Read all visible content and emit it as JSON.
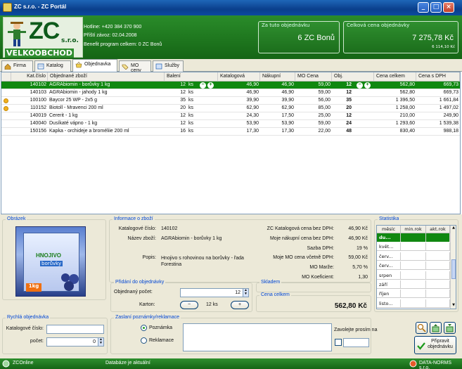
{
  "window": {
    "title": "ZC s.r.o. - ZC Portál"
  },
  "header": {
    "logo_text": "ZC",
    "logo_sro": "s.r.o.",
    "logo_tagline": "VELKOOBCHOD",
    "hotline": "Hotline: +420 384 370 900",
    "next_delivery": "Příští závoz: 02.04.2008",
    "benefit": "Benefit program celkem: 0 ZC Bonů",
    "bonus_label": "Za tuto objednávku",
    "bonus_value": "6 ZC Bonů",
    "total_label": "Celková cena objednávky",
    "total_value": "7 275,78 Kč",
    "total_sub": "6 114,10 Kč"
  },
  "tabs": [
    {
      "label": "Firma"
    },
    {
      "label": "Katalog"
    },
    {
      "label": "Objednavka"
    },
    {
      "label": "MO ceny"
    },
    {
      "label": "Služby"
    }
  ],
  "grid": {
    "columns": [
      "Kat.číslo",
      "Objednané zboží",
      "Balení",
      "Katalogová",
      "Nákupní",
      "MO Cena",
      "Obj.",
      "Cena celkem",
      "Cena s DPH"
    ],
    "rows": [
      {
        "dot": false,
        "kat": "140102",
        "name": "AGRAbiomin - borůvky 1 kg",
        "bal": "12",
        "unit": "ks",
        "katal": "46,90",
        "nak": "46,90",
        "mo": "59,00",
        "obj": "12",
        "celkem": "562,80",
        "dph": "669,73",
        "selected": true
      },
      {
        "dot": false,
        "kat": "140103",
        "name": "AGRAbiomin - jahody 1 kg",
        "bal": "12",
        "unit": "ks",
        "katal": "46,90",
        "nak": "46,90",
        "mo": "59,00",
        "obj": "12",
        "celkem": "562,80",
        "dph": "669,73",
        "selected": false
      },
      {
        "dot": true,
        "kat": "100100",
        "name": "Baycor 25 WP - 2x5 g",
        "bal": "35",
        "unit": "ks",
        "katal": "39,90",
        "nak": "39,90",
        "mo": "56,00",
        "obj": "35",
        "celkem": "1 396,50",
        "dph": "1 661,84",
        "selected": false
      },
      {
        "dot": true,
        "kat": "110152",
        "name": "Biotoll - Mravenci 200 ml",
        "bal": "20",
        "unit": "ks",
        "katal": "62,90",
        "nak": "62,90",
        "mo": "85,00",
        "obj": "20",
        "celkem": "1 258,00",
        "dph": "1 497,02",
        "selected": false
      },
      {
        "dot": false,
        "kat": "140019",
        "name": "Cererit - 1 kg",
        "bal": "12",
        "unit": "ks",
        "katal": "24,30",
        "nak": "17,50",
        "mo": "25,00",
        "obj": "12",
        "celkem": "210,00",
        "dph": "249,90",
        "selected": false
      },
      {
        "dot": false,
        "kat": "140040",
        "name": "Dusíkaté vápno - 1 kg",
        "bal": "12",
        "unit": "ks",
        "katal": "53,90",
        "nak": "53,90",
        "mo": "59,00",
        "obj": "24",
        "celkem": "1 293,60",
        "dph": "1 539,38",
        "selected": false
      },
      {
        "dot": false,
        "kat": "150156",
        "name": "Kapka - orchideje a broméliie 200 ml",
        "bal": "16",
        "unit": "ks",
        "katal": "17,30",
        "nak": "17,30",
        "mo": "22,00",
        "obj": "48",
        "celkem": "830,40",
        "dph": "988,18",
        "selected": false
      }
    ]
  },
  "image_panel": {
    "title": "Obrázek",
    "product_label": "HNOJIVO",
    "product_sub": "borůvky",
    "product_weight": "1kg"
  },
  "info": {
    "title": "Informace o zboží",
    "kat_label": "Katalogové číslo:",
    "kat_value": "140102",
    "name_label": "Název zboží:",
    "name_value": "AGRAbiomin - borůvky 1 kg",
    "popis_label": "Popis:",
    "popis_value": "Hnojivo s rohovinou na borůvky - řada Forestina",
    "k1_label": "ZC Katalogová cena bez DPH:",
    "k1_value": "46,90 Kč",
    "k2_label": "Moje nákupní cena bez DPH:",
    "k2_value": "46,90 Kč",
    "k3_label": "Sazba DPH:",
    "k3_value": "19 %",
    "k4_label": "Moje MO cena včetně DPH:",
    "k4_value": "59,00 Kč",
    "k5_label": "MO Marže:",
    "k5_value": "5,70 %",
    "k6_label": "MO Koeficient:",
    "k6_value": "1,30"
  },
  "add": {
    "title": "Přidání do objednávky",
    "qty_label": "Objednaný počet:",
    "qty_value": "12",
    "karton_label": "Karton:",
    "karton_value": "12 ks"
  },
  "sklad": {
    "title": "Skladem"
  },
  "cena": {
    "title": "Cena celkem",
    "value": "562,80 Kč"
  },
  "stats": {
    "title": "Statistika",
    "cols": [
      "měsíc",
      "min.rok",
      "akt.rok"
    ],
    "months": [
      "du...",
      "květ...",
      "červ...",
      "červ...",
      "srpen",
      "září",
      "říjen",
      "listo..."
    ]
  },
  "quick": {
    "title": "Rychlá objednávka",
    "kat_label": "Katalogové číslo:",
    "kat_value": "",
    "count_label": "počet:",
    "count_value": "0"
  },
  "note": {
    "title": "Zaslaní poznámky/reklamace",
    "opt1": "Poznámka",
    "opt2": "Reklamace",
    "call_label": "Zavolejte prosím na"
  },
  "prepare_button": {
    "label": "Připravit objednávku"
  },
  "status": {
    "left": "ZCOnline",
    "middle": "Databáze je aktuální",
    "right": "DATA-NORMS s.r.o."
  }
}
